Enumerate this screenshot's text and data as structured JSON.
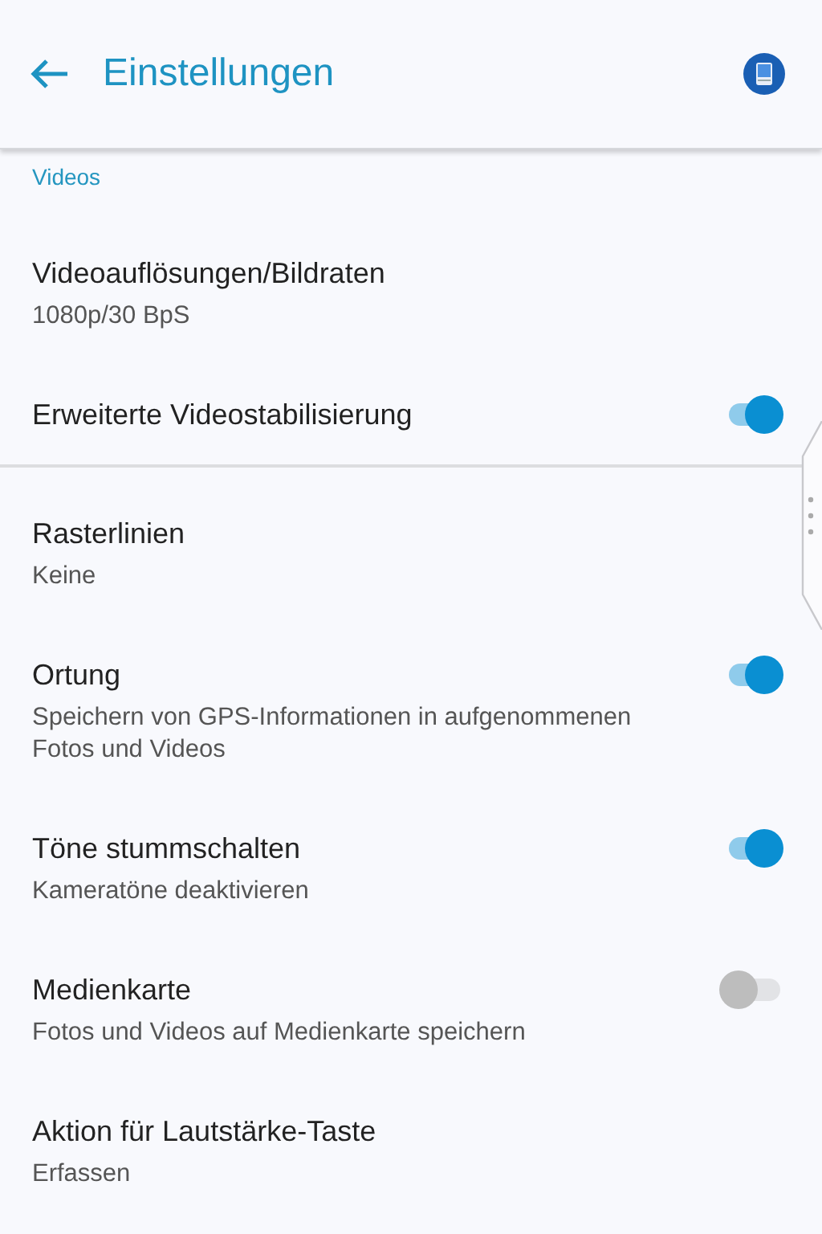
{
  "header": {
    "title": "Einstellungen"
  },
  "sections": [
    {
      "label": "Videos",
      "items": [
        {
          "kind": "value",
          "title": "Videoauflösungen/Bildraten",
          "subtitle": "1080p/30 BpS"
        },
        {
          "kind": "toggle",
          "title": "Erweiterte Videostabilisierung",
          "on": true
        }
      ]
    },
    {
      "items": [
        {
          "kind": "value",
          "title": "Rasterlinien",
          "subtitle": "Keine"
        },
        {
          "kind": "toggle",
          "title": "Ortung",
          "subtitle": "Speichern von GPS-Informationen in aufgenommenen Fotos und Videos",
          "on": true
        },
        {
          "kind": "toggle",
          "title": "Töne stummschalten",
          "subtitle": "Kameratöne deaktivieren",
          "on": true
        },
        {
          "kind": "toggle",
          "title": "Medienkarte",
          "subtitle": "Fotos und Videos auf Medienkarte speichern",
          "on": false
        },
        {
          "kind": "value",
          "title": "Aktion für Lautstärke-Taste",
          "subtitle": "Erfassen"
        }
      ]
    }
  ]
}
